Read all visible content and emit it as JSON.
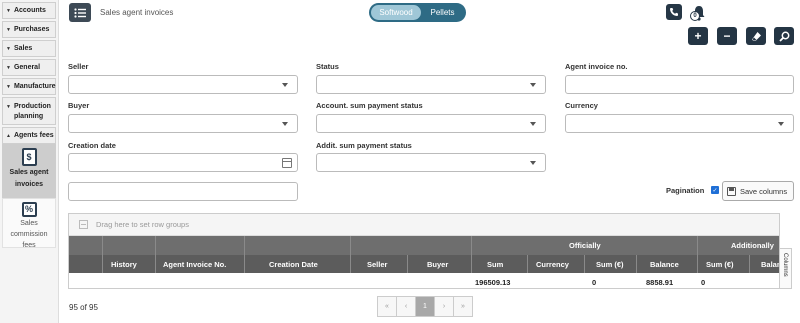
{
  "sidebar": {
    "items": [
      {
        "label": "Accounts"
      },
      {
        "label": "Purchases"
      },
      {
        "label": "Sales"
      },
      {
        "label": "General"
      },
      {
        "label": "Manufacture"
      },
      {
        "label": "Production planning"
      },
      {
        "label": "Agents fees"
      }
    ],
    "sub_active": {
      "label": "Sales agent invoices",
      "icon": "$"
    },
    "sub_other": {
      "label": "Sales commission fees",
      "icon": "%"
    }
  },
  "header": {
    "title": "Sales agent invoices",
    "toggle": [
      "Softwood",
      "Pellets"
    ],
    "notification_count": "0"
  },
  "form": {
    "seller_label": "Seller",
    "status_label": "Status",
    "agent_invoice_no_label": "Agent invoice no.",
    "buyer_label": "Buyer",
    "account_sum_status_label": "Account. sum payment status",
    "currency_label": "Currency",
    "creation_date_label": "Creation date",
    "addit_sum_status_label": "Addit. sum payment status"
  },
  "pagination": {
    "label": "Pagination",
    "checked": true,
    "save_columns": "Save columns"
  },
  "grid": {
    "group_hint": "Drag here to set row groups",
    "group_headers": {
      "officially": "Officially",
      "additionally": "Additionally"
    },
    "columns": [
      "History",
      "Agent Invoice No.",
      "Creation Date",
      "Seller",
      "Buyer",
      "Sum",
      "Currency",
      "Sum (€)",
      "Balance",
      "Sum (€)",
      "Balan"
    ],
    "totals": {
      "sum": "196509.13",
      "sum_eur": "0",
      "balance": "8858.91",
      "add_sum_eur": "0"
    },
    "columns_tab": "Columns"
  },
  "footer": {
    "count": "95 of 95",
    "pages": [
      "«",
      "‹",
      "1",
      "›",
      "»"
    ]
  }
}
